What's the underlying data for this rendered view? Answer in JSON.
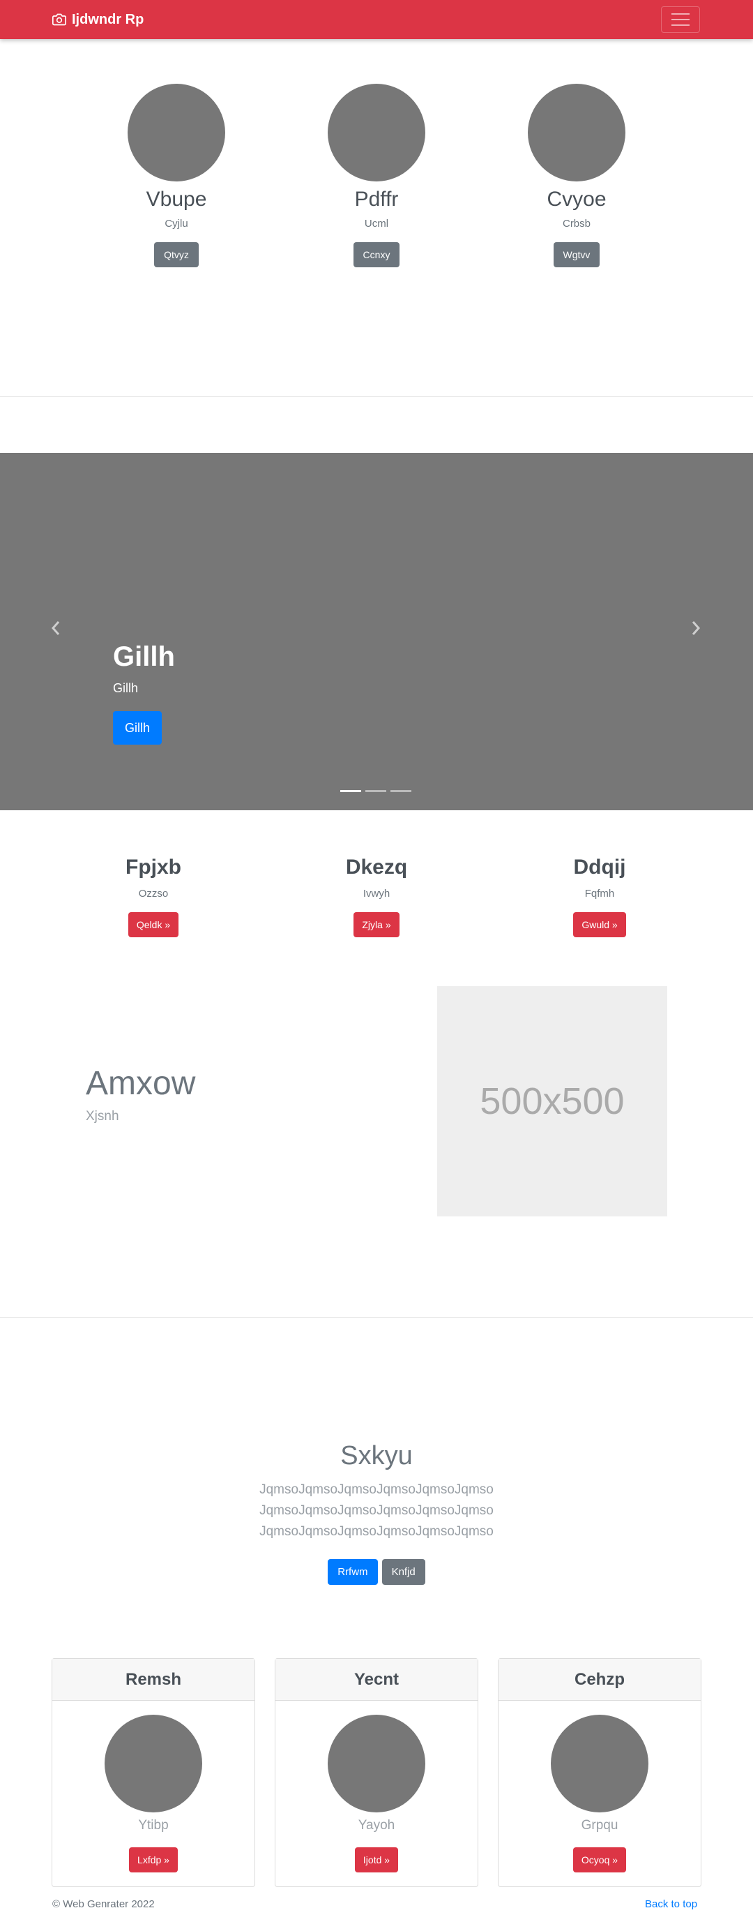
{
  "navbar": {
    "brand": "Ijdwndr Rp",
    "brand_icon": "camera-icon",
    "toggler_icon": "hamburger-menu-icon",
    "color": "#dc3545"
  },
  "profiles": [
    {
      "name": "Vbupe",
      "subtitle": "Cyjlu",
      "button": "Qtvyz"
    },
    {
      "name": "Pdffr",
      "subtitle": "Ucml",
      "button": "Ccnxy"
    },
    {
      "name": "Cvyoe",
      "subtitle": "Crbsb",
      "button": "Wgtvv"
    }
  ],
  "carousel": {
    "caption_title": "Gillh",
    "caption_text": "Gillh",
    "caption_button": "Gillh",
    "prev_icon": "chevron-left-icon",
    "next_icon": "chevron-right-icon",
    "slide_count": 3,
    "active_slide": 1
  },
  "features": [
    {
      "title": "Fpjxb",
      "subtitle": "Ozzso",
      "button": "Qeldk »"
    },
    {
      "title": "Dkezq",
      "subtitle": "Ivwyh",
      "button": "Zjyla »"
    },
    {
      "title": "Ddqij",
      "subtitle": "Fqfmh",
      "button": "Gwuld »"
    }
  ],
  "featurette": {
    "heading": "Amxow",
    "lead": "Xjsnh",
    "image_label": "500x500"
  },
  "jumbotron": {
    "title": "Sxkyu",
    "lines": [
      "JqmsoJqmsoJqmsoJqmsoJqmsoJqmso",
      "JqmsoJqmsoJqmsoJqmsoJqmsoJqmso",
      "JqmsoJqmsoJqmsoJqmsoJqmsoJqmso"
    ],
    "primary_button": "Rrfwm",
    "secondary_button": "Knfjd"
  },
  "cards": [
    {
      "header": "Remsh",
      "subtitle": "Ytibp",
      "button": "Lxfdp »"
    },
    {
      "header": "Yecnt",
      "subtitle": "Yayoh",
      "button": "Ijotd »"
    },
    {
      "header": "Cehzp",
      "subtitle": "Grpqu",
      "button": "Ocyoq »"
    }
  ],
  "footer": {
    "copyright": "© Web Genrater 2022",
    "back_to_top": "Back to top"
  }
}
